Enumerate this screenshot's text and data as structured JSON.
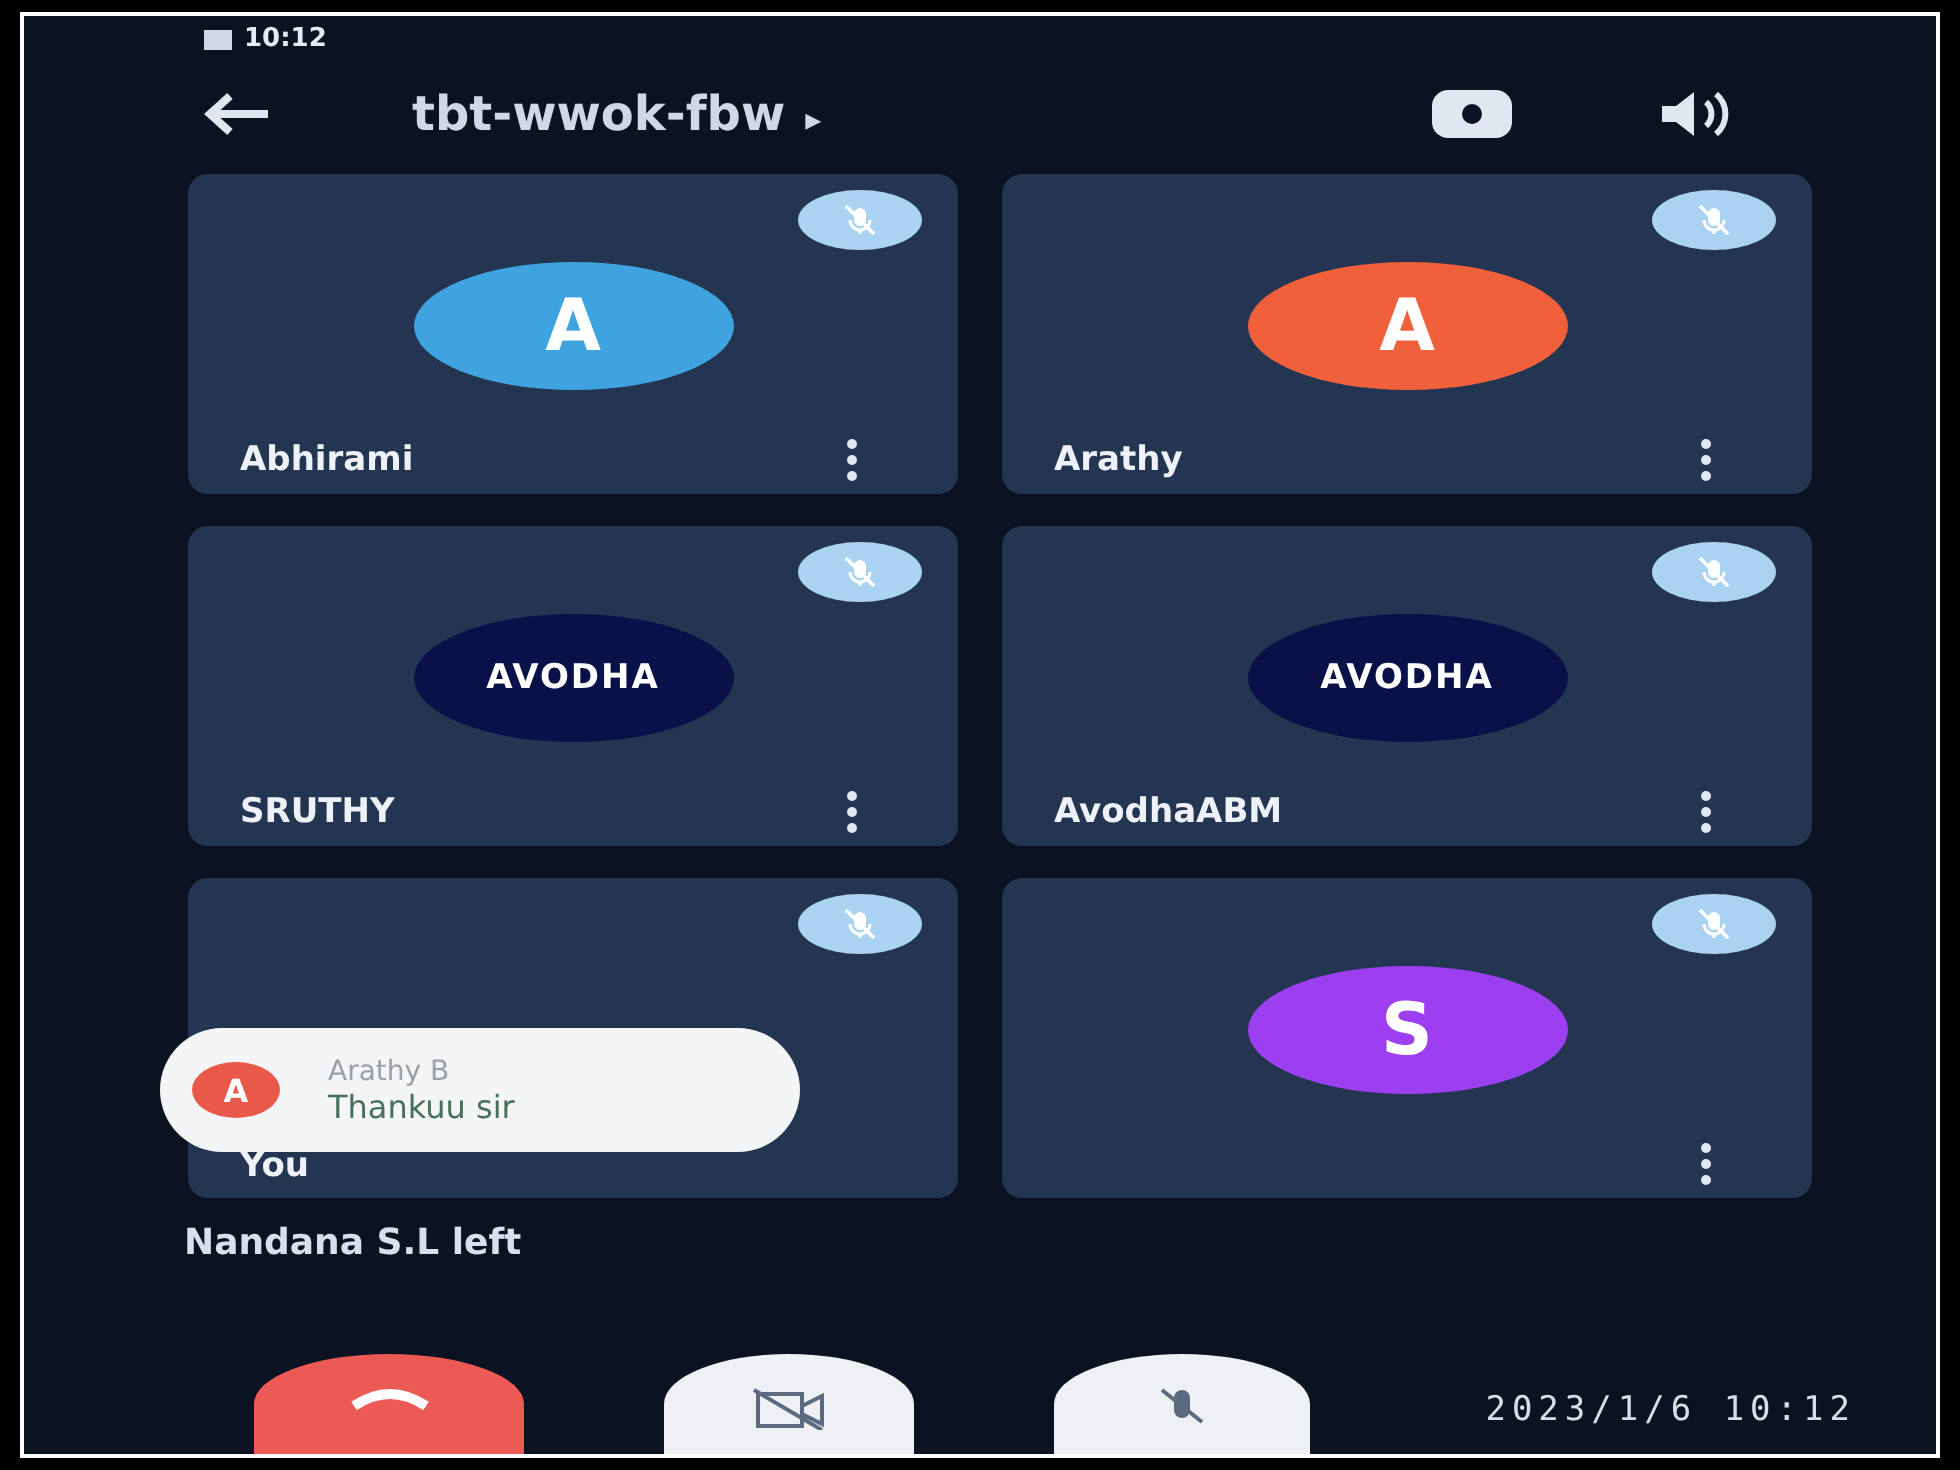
{
  "status_bar": {
    "time": "10:12"
  },
  "header": {
    "meeting_code": "tbt-wwok-fbw",
    "caret": "▸"
  },
  "tiles": [
    {
      "name": "Abhirami",
      "avatar": {
        "kind": "letter",
        "text": "A",
        "color": "#3fa3e0"
      },
      "muted": true
    },
    {
      "name": "Arathy",
      "avatar": {
        "kind": "letter",
        "text": "A",
        "color": "#f0603a"
      },
      "muted": true
    },
    {
      "name": "SRUTHY",
      "avatar": {
        "kind": "logo",
        "text": "AVODHA"
      },
      "muted": true
    },
    {
      "name": "AvodhaABM",
      "avatar": {
        "kind": "logo",
        "text": "AVODHA"
      },
      "muted": true
    },
    {
      "name": "You",
      "avatar": {
        "kind": "none"
      },
      "muted": true
    },
    {
      "avatar": {
        "kind": "letter",
        "text": "S",
        "color": "#9b3ff0"
      },
      "muted": true
    }
  ],
  "toast": {
    "initial": "A",
    "color": "#e8594a",
    "sender": "Arathy B",
    "message": "Thankuu sir"
  },
  "notice": "Nandana S.L left",
  "date_stamp": "2023/1/6 10:12"
}
